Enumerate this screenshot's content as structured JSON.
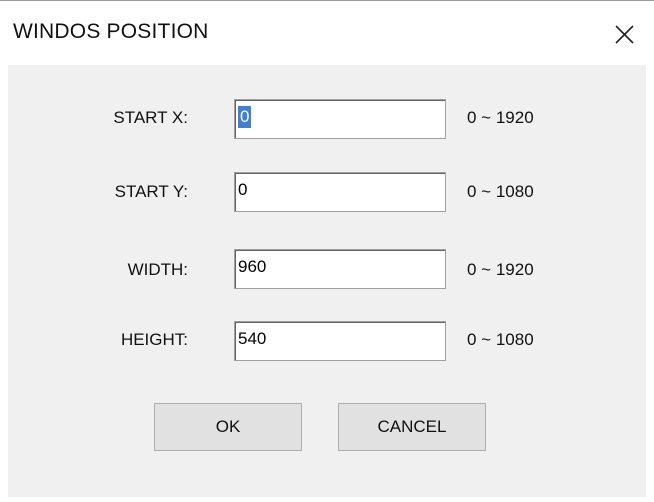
{
  "window": {
    "title": "WINDOS POSITION"
  },
  "fields": [
    {
      "label": "START X:",
      "value": "0",
      "range": "0 ~ 1920",
      "selected": true
    },
    {
      "label": "START Y:",
      "value": "0",
      "range": "0 ~ 1080",
      "selected": false
    },
    {
      "label": "WIDTH:",
      "value": "960",
      "range": "0 ~ 1920",
      "selected": false
    },
    {
      "label": "HEIGHT:",
      "value": "540",
      "range": "0 ~ 1080",
      "selected": false
    }
  ],
  "buttons": {
    "ok_label": "OK",
    "cancel_label": "CANCEL"
  },
  "icons": {
    "close": "close-icon"
  },
  "colors": {
    "dialog_background": "#f0f0f0",
    "selection_highlight": "#3f7fd6"
  }
}
